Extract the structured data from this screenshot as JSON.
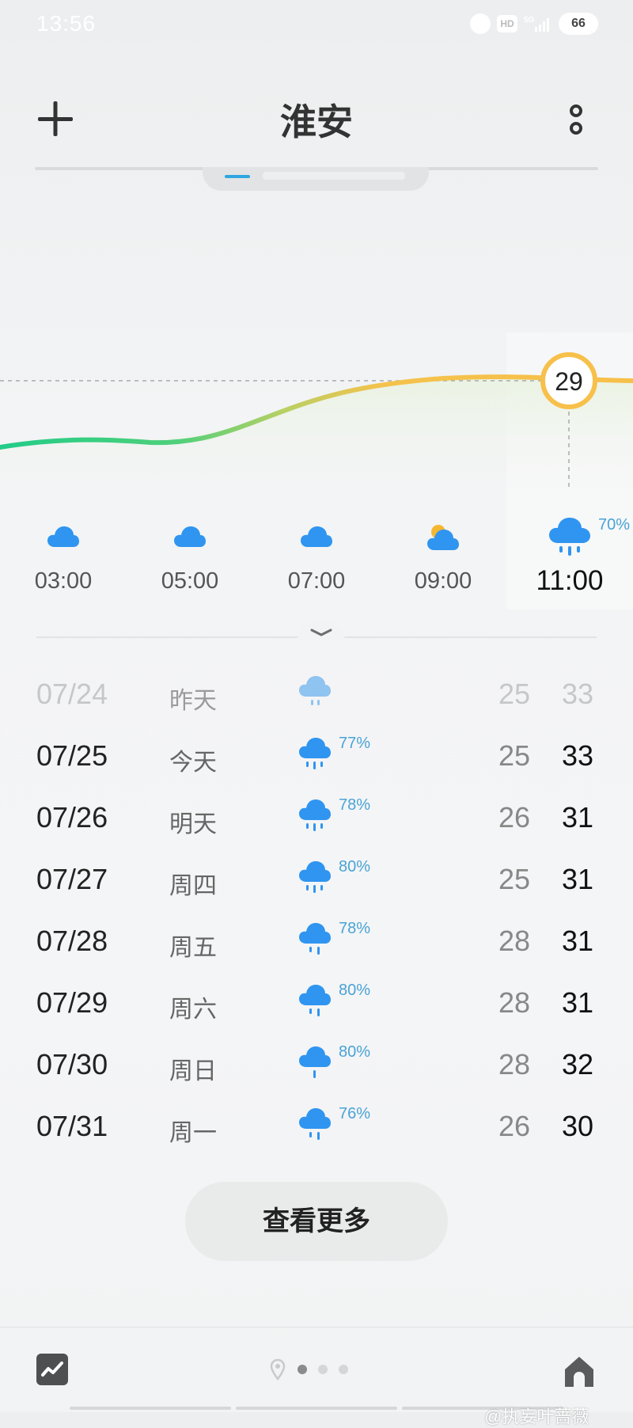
{
  "status_bar": {
    "time": "13:56",
    "hd": "HD",
    "network": "5G",
    "battery": "66"
  },
  "header": {
    "city": "淮安"
  },
  "hourly": {
    "current_temp": "29",
    "items": [
      {
        "time": "03:00",
        "icon": "cloud-icon",
        "precip": ""
      },
      {
        "time": "05:00",
        "icon": "cloud-icon",
        "precip": ""
      },
      {
        "time": "07:00",
        "icon": "cloud-icon",
        "precip": ""
      },
      {
        "time": "09:00",
        "icon": "partly-cloudy-icon",
        "precip": ""
      },
      {
        "time": "11:00",
        "icon": "rain-cloud-icon",
        "precip": "70%"
      }
    ]
  },
  "daily": [
    {
      "date": "07/24",
      "weekday": "昨天",
      "precip": "",
      "low": "25",
      "high": "33"
    },
    {
      "date": "07/25",
      "weekday": "今天",
      "precip": "77%",
      "low": "25",
      "high": "33"
    },
    {
      "date": "07/26",
      "weekday": "明天",
      "precip": "78%",
      "low": "26",
      "high": "31"
    },
    {
      "date": "07/27",
      "weekday": "周四",
      "precip": "80%",
      "low": "25",
      "high": "31"
    },
    {
      "date": "07/28",
      "weekday": "周五",
      "precip": "78%",
      "low": "28",
      "high": "31"
    },
    {
      "date": "07/29",
      "weekday": "周六",
      "precip": "80%",
      "low": "28",
      "high": "31"
    },
    {
      "date": "07/30",
      "weekday": "周日",
      "precip": "80%",
      "low": "28",
      "high": "32"
    },
    {
      "date": "07/31",
      "weekday": "周一",
      "precip": "76%",
      "low": "26",
      "high": "30"
    }
  ],
  "more_button": "查看更多",
  "watermark": "@执妄叶蔷薇",
  "colors": {
    "rain_blue": "#2f95f0",
    "precip_text": "#4aa3d6",
    "curve_green": "#2ecc80",
    "curve_yellow": "#f7c04a"
  }
}
